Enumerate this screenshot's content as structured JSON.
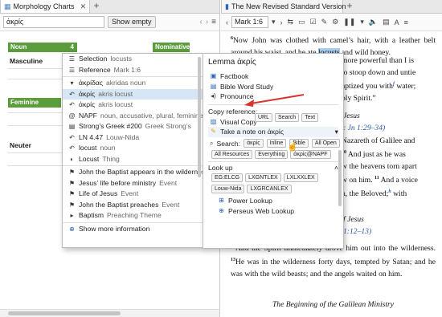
{
  "left_pane": {
    "tab_title": "Morphology Charts",
    "search_value": "ἀκρίς",
    "show_empty_label": "Show empty",
    "chart": {
      "col_noun": "Noun",
      "col_noun_count": "4",
      "col_nominative": "Nominative",
      "rows": [
        "Masculine",
        "Feminine",
        "Neuter"
      ]
    }
  },
  "right_pane": {
    "tab_title": "The New Revised Standard Version",
    "reference": "Mark 1:6",
    "text": {
      "v6_num": "6",
      "v6a": "Now John was clothed with camel’s hair, with a leather belt around his waist, and he ate ",
      "v6_hl": "locusts",
      "v6b": " and wild honey.",
      "frag1": "more powerful than I is",
      "frag2": "to stoop down and untie",
      "frag3a": "aptized you with",
      "frag3_sup": "f",
      "frag3b": " water;",
      "frag4": "oly Spirit.”",
      "h_jesus": "Jesus",
      "ref1": ": Jn 1:29–34)",
      "frag5": "Nazareth of Galilee and",
      "frag6a": "10",
      "frag6b": " And just as he was",
      "frag7": "w the heavens torn apart",
      "frag8a": "w on him. ",
      "frag8_sup": "11",
      "frag8b": " And a voice",
      "frag9a": "n, the Beloved;",
      "frag9_sup": "h",
      "frag9b": " with",
      "h_jesus2": "f Jesus",
      "ref2": "1:12–13)",
      "v12_num": "12",
      "v12": "And the Spirit immediately drove him out into the wilderness. ",
      "v13_num": "13",
      "v13": "He was in the wilderness forty days, tempted by Satan; and he was with the wild beasts; and the angels waited on him.",
      "section": "The Beginning of the Galilean Ministry"
    }
  },
  "popup_left": {
    "items": [
      {
        "icon": "☰",
        "label": "Selection",
        "gloss": "locusts"
      },
      {
        "icon": "☰",
        "label": "Reference",
        "gloss": "Mark 1:6"
      },
      {
        "icon": "▾",
        "label": "ἀκρίδας",
        "gloss": "akridas noun",
        "italic": "akridas"
      },
      {
        "icon": "↶",
        "label": "ἀκρίς",
        "gloss": "akris locust",
        "sel": true
      },
      {
        "icon": "↶",
        "label": "ἀκρίς",
        "gloss": "akris locust"
      },
      {
        "icon": "@",
        "label": "NAPF",
        "gloss": "noun, accusative, plural, feminine"
      },
      {
        "icon": "▤",
        "label": "Strong’s Greek #200",
        "gloss": "Greek Strong’s"
      },
      {
        "icon": "↶",
        "label": "LN 4.47",
        "gloss": "Louw-Nida"
      },
      {
        "icon": "↶",
        "label": "locust",
        "gloss": "noun"
      },
      {
        "icon": "◐",
        "label": "Locust",
        "gloss": "Thing"
      },
      {
        "icon": "⚑",
        "label": "John the Baptist appears in the wilderness",
        "gloss": ""
      },
      {
        "icon": "⚑",
        "label": "Jesus’ life before ministry",
        "gloss": "Event"
      },
      {
        "icon": "⚑",
        "label": "Life of Jesus",
        "gloss": "Event"
      },
      {
        "icon": "⚑",
        "label": "John the Baptist preaches",
        "gloss": "Event"
      },
      {
        "icon": "▸",
        "label": "Baptism",
        "gloss": "Preaching Theme"
      }
    ],
    "more": "Show more information"
  },
  "popup_right": {
    "title_prefix": "Lemma",
    "title_word": "ἀκρίς",
    "links": [
      "Factbook",
      "Bible Word Study",
      "Pronounce"
    ],
    "copy_label": "Copy reference:",
    "copy_chips": [
      "URL",
      "Search",
      "Text"
    ],
    "visual_copy": "Visual Copy",
    "note": "Take a note on ἀκρίς",
    "search_label": "Search:",
    "search_chips": [
      "ἀκρίς",
      "Inline",
      "Bible",
      "All Open",
      "All Resources",
      "Everything",
      "ἀκρίς@NAPF"
    ],
    "lookup_label": "Look up",
    "lookup_chips": [
      "EG:ELCG",
      "LXGNTLEX",
      "LXLXXLEX",
      "Louw-Nida",
      "LXGRCANLEX"
    ],
    "power_lookup": "Power Lookup",
    "perseus": "Perseus Web Lookup"
  }
}
